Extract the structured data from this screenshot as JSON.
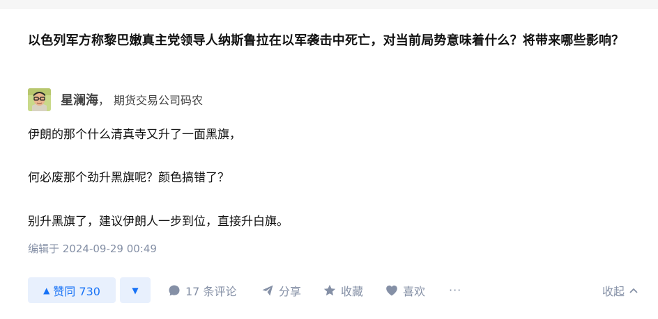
{
  "question": {
    "title": "以色列军方称黎巴嫩真主党领导人纳斯鲁拉在以军袭击中死亡，对当前局势意味着什么？将带来哪些影响？"
  },
  "author": {
    "name": "星澜海",
    "separator": "，",
    "headline": "期货交易公司码农",
    "avatar_icon": "avatar-image"
  },
  "answer": {
    "paragraphs": [
      "伊朗的那个什么清真寺又升了一面黑旗，",
      "何必废那个劲升黑旗呢？颜色搞错了？",
      "别升黑旗了，建议伊朗人一步到位，直接升白旗。"
    ],
    "edit_time": "编辑于 2024-09-29 00:49"
  },
  "actions": {
    "vote_up_icon": "triangle-up-icon",
    "vote_up_label": "赞同 730",
    "vote_down_icon": "triangle-down-icon",
    "comment_label": "17 条评论",
    "share_label": "分享",
    "favorite_label": "收藏",
    "like_label": "喜欢",
    "more_label": "···",
    "collapse_label": "收起"
  },
  "colors": {
    "primary": "#1772f6",
    "primary_bg": "#e8f0fd",
    "muted": "#8590a6",
    "text": "#121212"
  }
}
